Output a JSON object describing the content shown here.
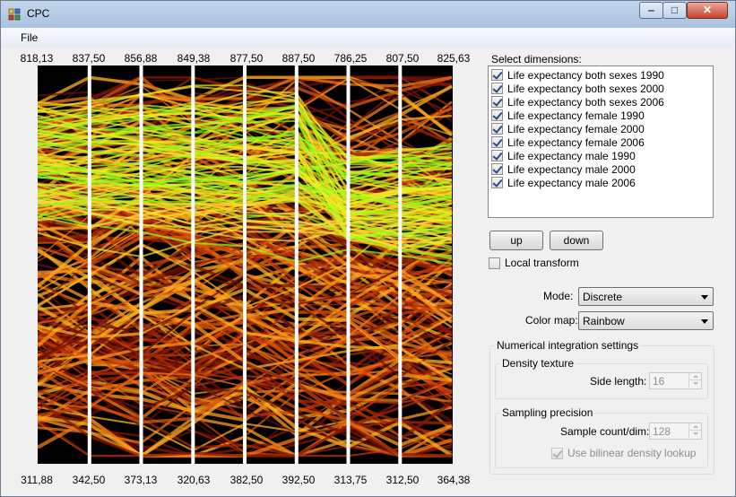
{
  "window": {
    "title": "CPC",
    "minimize_glyph": "‒",
    "maximize_glyph": "□",
    "close_glyph": "✕"
  },
  "menu": {
    "file": "File"
  },
  "chart_data": {
    "type": "parallel-coordinates",
    "axes_count": 9,
    "axis_max": [
      "818,13",
      "837,50",
      "856,88",
      "849,38",
      "877,50",
      "887,50",
      "786,25",
      "807,50",
      "825,63"
    ],
    "axis_min": [
      "311,88",
      "342,50",
      "373,13",
      "320,63",
      "382,50",
      "392,50",
      "313,75",
      "312,50",
      "364,38"
    ],
    "color_map": "Rainbow",
    "background": "#000000"
  },
  "dimensions": {
    "label": "Select dimensions:",
    "items": [
      {
        "label": "Life expectancy both sexes 1990",
        "checked": true
      },
      {
        "label": "Life expectancy both sexes 2000",
        "checked": true
      },
      {
        "label": "Life expectancy both sexes 2006",
        "checked": true
      },
      {
        "label": "Life expectancy female 1990",
        "checked": true
      },
      {
        "label": "Life expectancy female 2000",
        "checked": true
      },
      {
        "label": "Life expectancy female 2006",
        "checked": true
      },
      {
        "label": "Life expectancy male 1990",
        "checked": true
      },
      {
        "label": "Life expectancy male 2000",
        "checked": true
      },
      {
        "label": "Life expectancy male 2006",
        "checked": true
      }
    ]
  },
  "buttons": {
    "up": "up",
    "down": "down"
  },
  "local_transform": {
    "label": "Local transform",
    "checked": false
  },
  "mode": {
    "label": "Mode:",
    "value": "Discrete"
  },
  "color_map": {
    "label": "Color map:",
    "value": "Rainbow"
  },
  "integration": {
    "title": "Numerical integration settings",
    "density_texture": {
      "title": "Density texture",
      "side_length_label": "Side length:",
      "side_length_value": "16"
    },
    "sampling": {
      "title": "Sampling precision",
      "sample_count_label": "Sample count/dim:",
      "sample_count_value": "128",
      "bilinear_label": "Use bilinear density lookup",
      "bilinear_checked": true
    }
  }
}
